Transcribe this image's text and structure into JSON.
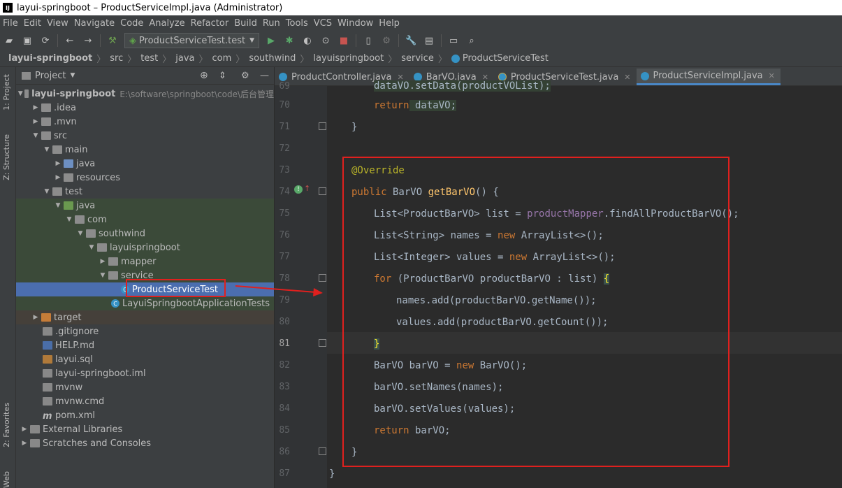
{
  "window": {
    "title": "layui-springboot – ProductServiceImpl.java (Administrator)"
  },
  "menu": [
    "File",
    "Edit",
    "View",
    "Navigate",
    "Code",
    "Analyze",
    "Refactor",
    "Build",
    "Run",
    "Tools",
    "VCS",
    "Window",
    "Help"
  ],
  "toolbar": {
    "run_config": "ProductServiceTest.test"
  },
  "breadcrumb": [
    "layui-springboot",
    "src",
    "test",
    "java",
    "com",
    "southwind",
    "layuispringboot",
    "service",
    "ProductServiceTest"
  ],
  "sidebar_tabs": {
    "project": "1: Project",
    "structure": "Z: Structure",
    "favorites": "2: Favorites",
    "web": "Web"
  },
  "project_panel": {
    "title": "Project"
  },
  "tree": [
    {
      "label": "layui-springboot",
      "extra": "E:\\software\\springboot\\code\\后台管理"
    },
    {
      "label": ".idea"
    },
    {
      "label": ".mvn"
    },
    {
      "label": "src"
    },
    {
      "label": "main"
    },
    {
      "label": "java"
    },
    {
      "label": "resources"
    },
    {
      "label": "test"
    },
    {
      "label": "java"
    },
    {
      "label": "com"
    },
    {
      "label": "southwind"
    },
    {
      "label": "layuispringboot"
    },
    {
      "label": "mapper"
    },
    {
      "label": "service"
    },
    {
      "label": "ProductServiceTest"
    },
    {
      "label": "LayuiSpringbootApplicationTests"
    },
    {
      "label": "target"
    },
    {
      "label": ".gitignore"
    },
    {
      "label": "HELP.md"
    },
    {
      "label": "layui.sql"
    },
    {
      "label": "layui-springboot.iml"
    },
    {
      "label": "mvnw"
    },
    {
      "label": "mvnw.cmd"
    },
    {
      "label": "pom.xml"
    },
    {
      "label": "External Libraries"
    },
    {
      "label": "Scratches and Consoles"
    }
  ],
  "tabs": [
    "ProductController.java",
    "BarVO.java",
    "ProductServiceTest.java",
    "ProductServiceImpl.java"
  ],
  "lines": [
    "69",
    "70",
    "71",
    "72",
    "73",
    "74",
    "75",
    "76",
    "77",
    "78",
    "79",
    "80",
    "81",
    "82",
    "83",
    "84",
    "85",
    "86",
    "87"
  ],
  "code": {
    "l69": "dataVO.setData(productVOList);",
    "l70a": "return",
    "l70b": " dataVO;",
    "l71": "}",
    "l73": "@Override",
    "l74a": "public",
    "l74b": " BarVO ",
    "l74c": "getBarVO",
    "l74d": "() {",
    "l75a": "List<ProductBarVO> list = ",
    "l75b": "productMapper",
    "l75c": ".findAllProductBarVO();",
    "l76a": "List<String> names = ",
    "l76b": "new",
    "l76c": " ArrayList<>();",
    "l77a": "List<Integer> values = ",
    "l77b": "new",
    "l77c": " ArrayList<>();",
    "l78a": "for",
    "l78b": " (ProductBarVO productBarVO : list) ",
    "l78c": "{",
    "l79": "names.add(productBarVO.getName());",
    "l80": "values.add(productBarVO.getCount());",
    "l81": "}",
    "l82a": "BarVO barVO = ",
    "l82b": "new",
    "l82c": " BarVO();",
    "l83": "barVO.setNames(names);",
    "l84": "barVO.setValues(values);",
    "l85a": "return",
    "l85b": " barVO;",
    "l86": "}",
    "l87": "}"
  }
}
